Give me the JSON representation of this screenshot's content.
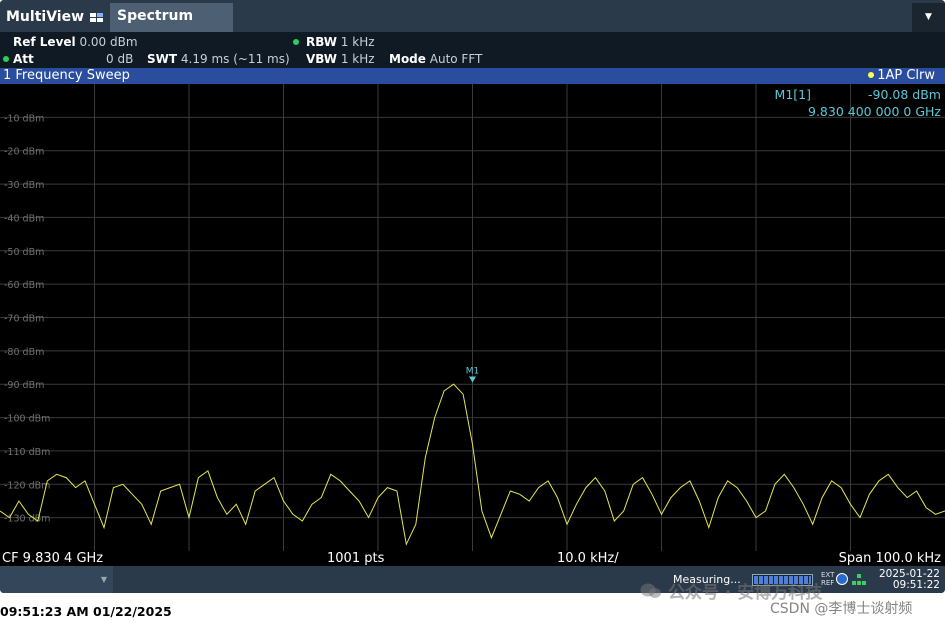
{
  "tabs": {
    "multiview": "MultiView",
    "spectrum": "Spectrum",
    "dropdown": "▼"
  },
  "settings": {
    "ref_level_label": "Ref Level",
    "ref_level_value": "0.00 dBm",
    "att_label": "Att",
    "att_value": "0 dB",
    "swt_label": "SWT",
    "swt_value": "4.19 ms (~11 ms)",
    "rbw_label": "RBW",
    "rbw_value": "1 kHz",
    "vbw_label": "VBW",
    "vbw_value": "1 kHz",
    "mode_label": "Mode",
    "mode_value": "Auto FFT"
  },
  "window": {
    "title": "1 Frequency Sweep",
    "trace_info": "1AP Clrw"
  },
  "marker": {
    "label": "M1[1]",
    "level": "-90.08 dBm",
    "frequency": "9.830 400 000 0 GHz",
    "tag": "M1"
  },
  "y_axis_labels": [
    "-10 dBm",
    "-20 dBm",
    "-30 dBm",
    "-40 dBm",
    "-50 dBm",
    "-60 dBm",
    "-70 dBm",
    "-80 dBm",
    "-90 dBm",
    "-100 dBm",
    "-110 dBm",
    "-120 dBm",
    "-130 dBm"
  ],
  "info_line": {
    "cf": "CF 9.830 4 GHz",
    "points": "1001 pts",
    "div": "10.0 kHz/",
    "span": "Span 100.0 kHz"
  },
  "status": {
    "measuring": "Measuring...",
    "ext_ref": "EXT\nREF",
    "date": "2025-01-22",
    "time": "09:51:22",
    "progress": 1.0,
    "left_arrow": "▼"
  },
  "footer": {
    "timestamp": "09:51:23 AM  01/22/2025"
  },
  "watermark": {
    "text": "公众号 · 安博万科技",
    "csdn": "CSDN @李博士谈射频"
  },
  "colors": {
    "trace": "#e6e650",
    "marker": "#5ac8d8",
    "grid": "#3a3a3a",
    "title_bar": "#2a4d9e"
  },
  "chart_data": {
    "type": "line",
    "x_range_khz": [
      -50,
      50
    ],
    "ylim": [
      -140,
      0
    ],
    "x_offset_khz": [
      -50,
      -49,
      -48,
      -47,
      -46,
      -45,
      -44,
      -43,
      -42,
      -41,
      -40,
      -39,
      -38,
      -37,
      -36,
      -35,
      -34,
      -33,
      -32,
      -31,
      -30,
      -29,
      -28,
      -27,
      -26,
      -25,
      -24,
      -23,
      -22,
      -21,
      -20,
      -19,
      -18,
      -17,
      -16,
      -15,
      -14,
      -13,
      -12,
      -11,
      -10,
      -9,
      -8,
      -7,
      -6,
      -5,
      -4,
      -3,
      -2,
      -1,
      0,
      1,
      2,
      3,
      4,
      5,
      6,
      7,
      8,
      9,
      10,
      11,
      12,
      13,
      14,
      15,
      16,
      17,
      18,
      19,
      20,
      21,
      22,
      23,
      24,
      25,
      26,
      27,
      28,
      29,
      30,
      31,
      32,
      33,
      34,
      35,
      36,
      37,
      38,
      39,
      40,
      41,
      42,
      43,
      44,
      45,
      46,
      47,
      48,
      49,
      50
    ],
    "y_dbm": [
      -128,
      -130,
      -125,
      -129,
      -131,
      -119,
      -117,
      -118,
      -121,
      -119,
      -126,
      -133,
      -121,
      -120,
      -123,
      -126,
      -132,
      -122,
      -121,
      -120,
      -130,
      -118,
      -116,
      -124,
      -129,
      -126,
      -132,
      -122,
      -120,
      -118,
      -125,
      -129,
      -131,
      -126,
      -124,
      -117,
      -119,
      -122,
      -125,
      -130,
      -124,
      -121,
      -122,
      -138,
      -132,
      -112,
      -100,
      -92,
      -90,
      -93,
      -108,
      -128,
      -136,
      -129,
      -122,
      -123,
      -125,
      -121,
      -119,
      -124,
      -132,
      -126,
      -121,
      -118,
      -122,
      -131,
      -128,
      -120,
      -118,
      -123,
      -129,
      -124,
      -121,
      -119,
      -125,
      -133,
      -124,
      -119,
      -121,
      -125,
      -130,
      -128,
      -120,
      -117,
      -121,
      -126,
      -132,
      -124,
      -119,
      -121,
      -126,
      -130,
      -123,
      -119,
      -117,
      -121,
      -124,
      -122,
      -127,
      -129,
      -128
    ],
    "marker": {
      "x_offset_khz": 0,
      "y_dbm": -90.08
    }
  }
}
